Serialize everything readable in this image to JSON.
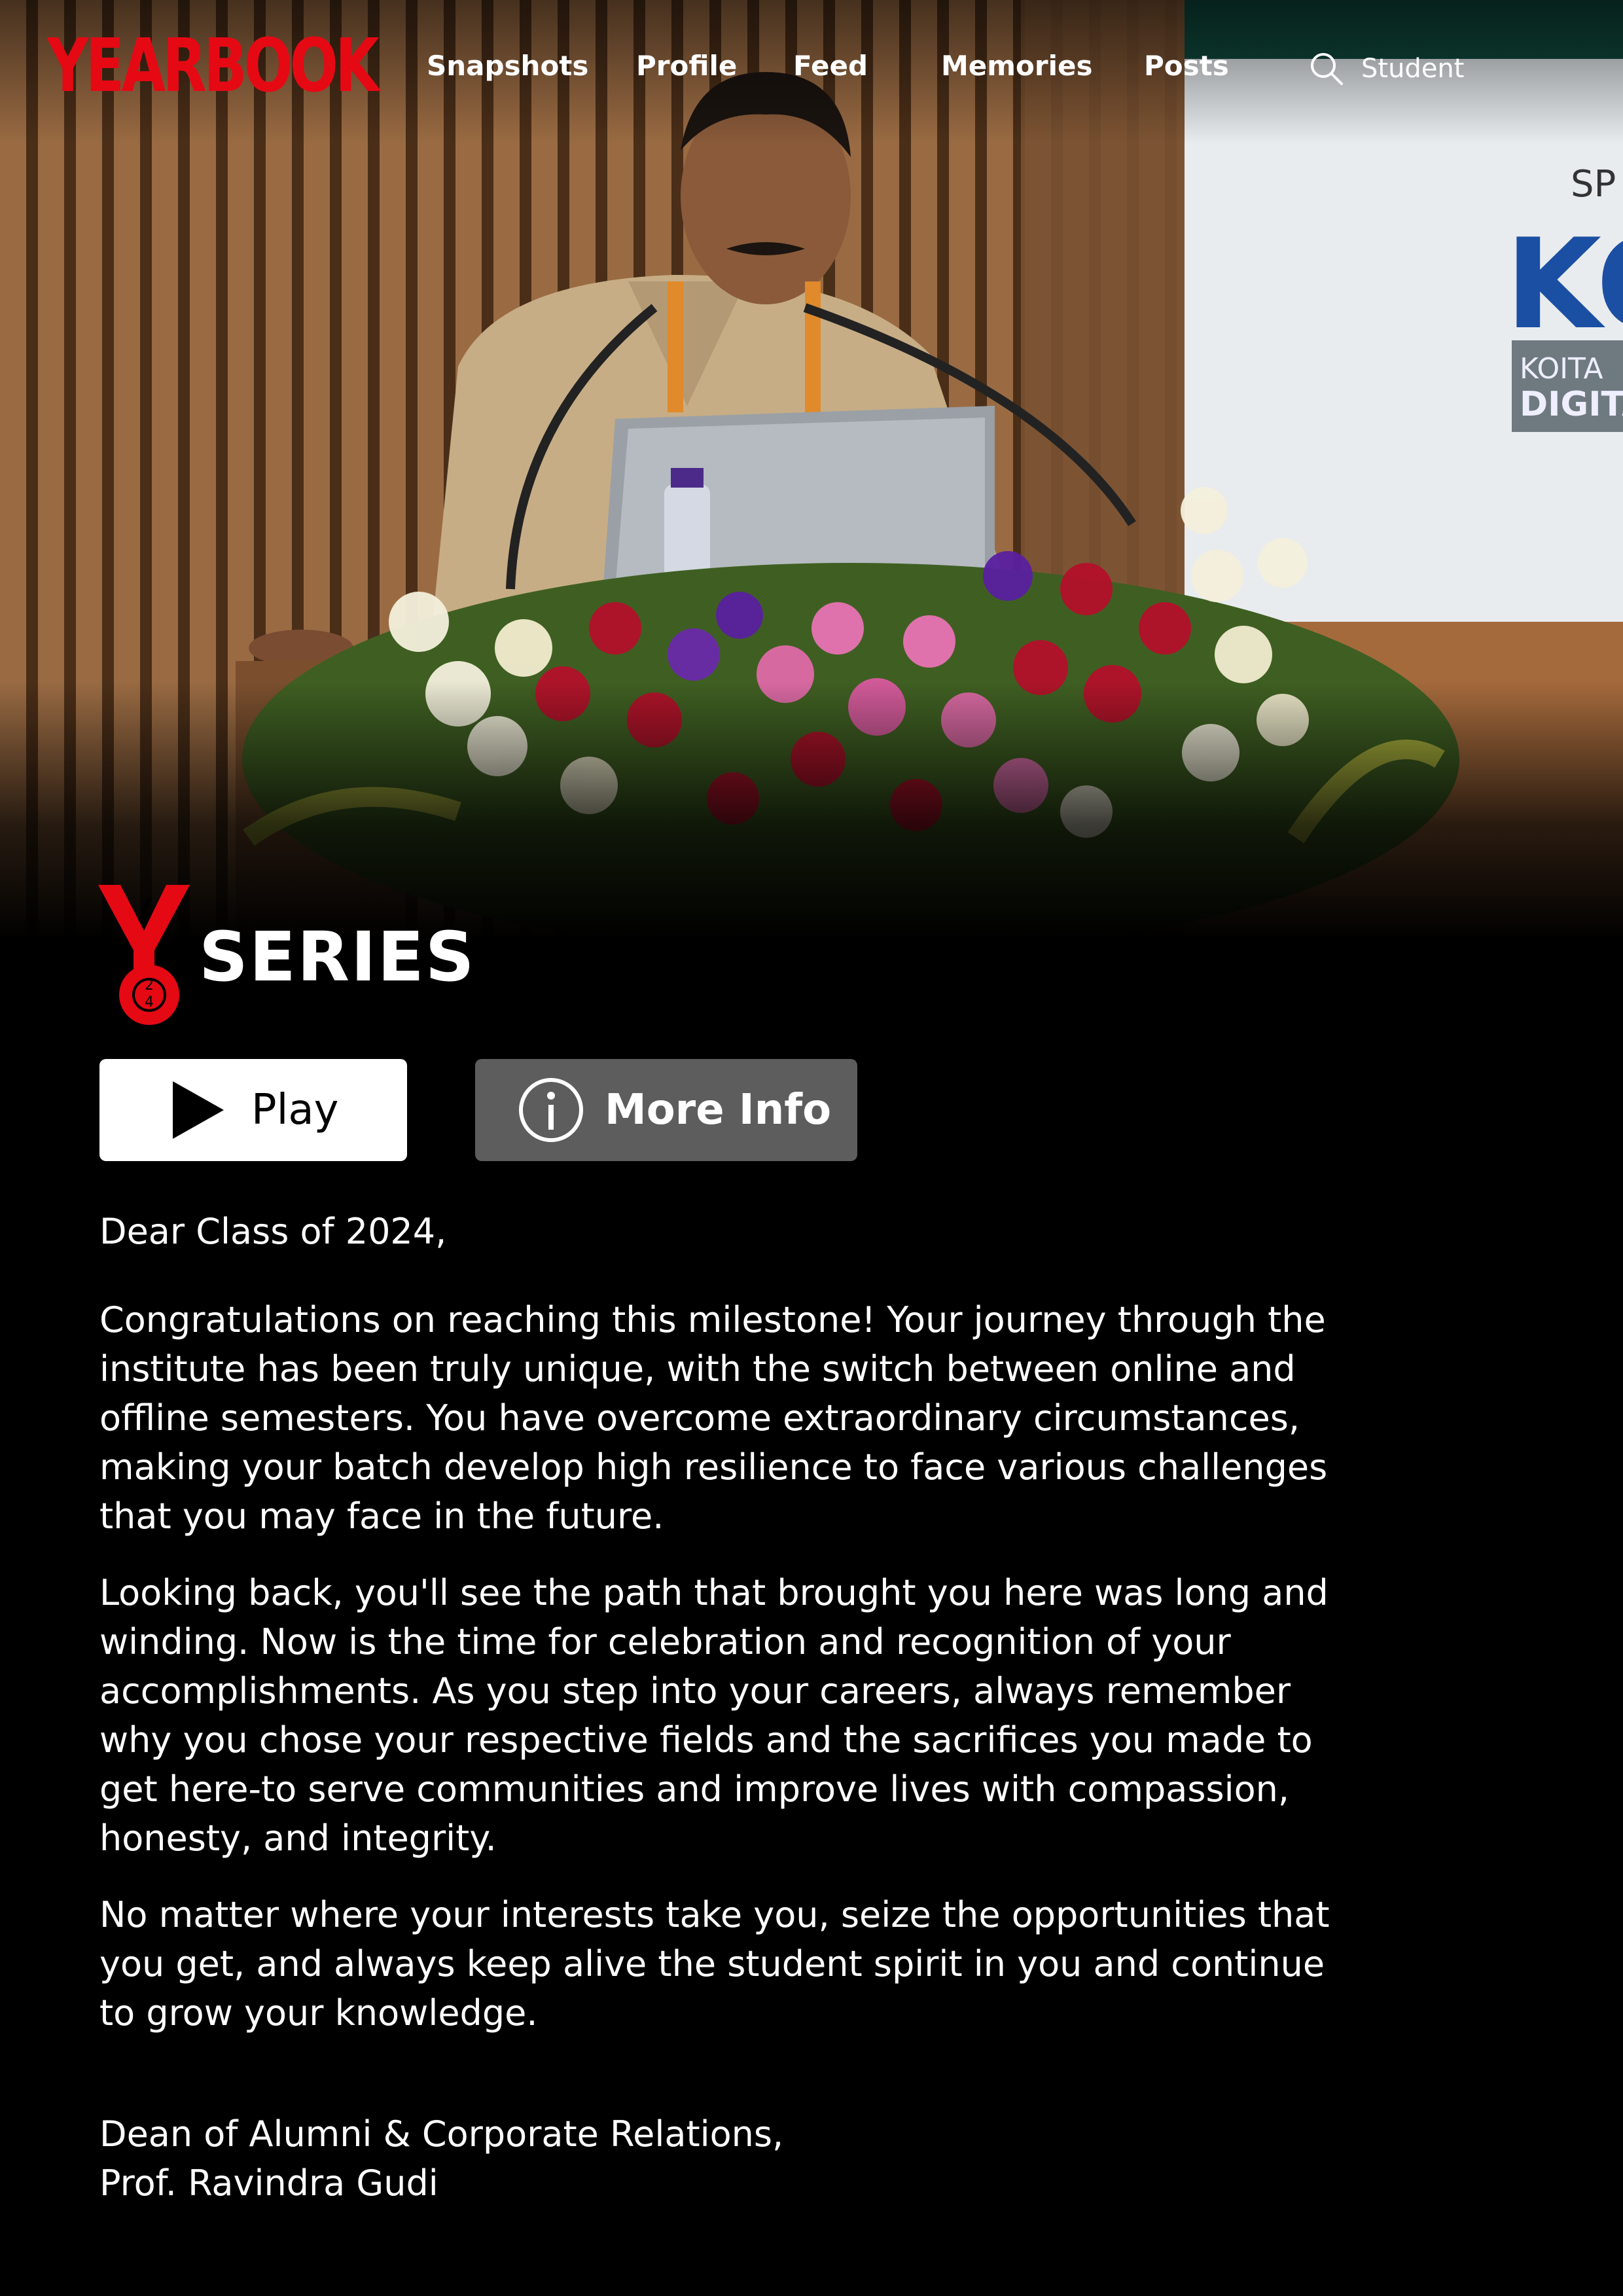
{
  "nav": {
    "logo": "YEARBOOK",
    "links": [
      "Snapshots",
      "Profile",
      "Feed",
      "Memories",
      "Posts"
    ],
    "search_label": "Student"
  },
  "hero": {
    "backdrop_text": [
      "SP",
      "KO",
      "KOITA",
      "DIGITA"
    ]
  },
  "series": {
    "emblem_digits": [
      "2",
      "4"
    ],
    "title": "SERIES"
  },
  "buttons": {
    "play": "Play",
    "more_info": "More Info"
  },
  "letter": {
    "greeting": "Dear Class of 2024,",
    "paragraphs": [
      "Congratulations on reaching this milestone! Your journey through the institute has been truly unique, with the switch between online and offline semesters. You have overcome extraordinary circumstances, making your batch develop high resilience to face various challenges that you may face in the future.",
      "Looking back, you'll see the path that brought you here was long and winding. Now is the time for celebration and recognition of your accomplishments. As you step into your careers, always remember why you chose your respective fields and the sacrifices you made to get here-to serve communities and improve lives with compassion, honesty, and integrity.",
      "No matter where your interests take you, seize the opportunities that you get, and always keep alive the student spirit in you and continue to grow your knowledge."
    ],
    "signature_title": "Dean of Alumni & Corporate Relations,",
    "signature_name": "Prof. Ravindra Gudi"
  },
  "colors": {
    "brand_red": "#e50914",
    "background": "#000000",
    "info_button": "#6d6d6e"
  }
}
